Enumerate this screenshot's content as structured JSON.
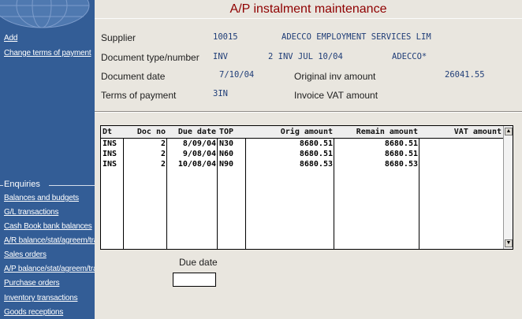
{
  "window": {
    "title": "A/P instalment maintenance"
  },
  "sidebar": {
    "actions": [
      {
        "label": "Add"
      },
      {
        "label": "Change terms of payment"
      }
    ],
    "enquiries_header": "Enquiries",
    "enquiries": [
      {
        "label": "Balances and budgets"
      },
      {
        "label": "G/L transactions"
      },
      {
        "label": "Cash Book bank balances"
      },
      {
        "label": "A/R balance/stat/agreem/tran"
      },
      {
        "label": "Sales orders"
      },
      {
        "label": "A/P balance/stat/agreem/tran"
      },
      {
        "label": "Purchase orders"
      },
      {
        "label": "Inventory transactions"
      },
      {
        "label": "Goods receptions"
      }
    ]
  },
  "header": {
    "supplier_label": "Supplier",
    "supplier_code": "10015",
    "supplier_name": "ADECCO EMPLOYMENT SERVICES LIM",
    "doc_label": "Document type/number",
    "doc_type": "INV",
    "doc_number": "2 INV  JUL 10/04",
    "doc_ref": "ADECCO*",
    "date_label": "Document date",
    "date_value": "7/10/04",
    "orig_label": "Original inv amount",
    "orig_value": "26041.55",
    "terms_label": "Terms of payment",
    "terms_value": "3IN",
    "vat_label": "Invoice VAT amount",
    "vat_value": ""
  },
  "grid": {
    "columns": [
      "Dt",
      "Doc no",
      "Due date",
      "TOP",
      "Orig amount",
      "Remain amount",
      "VAT amount"
    ],
    "rows": [
      [
        "INS",
        "2",
        "8/09/04",
        "N30",
        "8680.51",
        "8680.51",
        ""
      ],
      [
        "INS",
        "2",
        "9/08/04",
        "N60",
        "8680.51",
        "8680.51",
        ""
      ],
      [
        "INS",
        "2",
        "10/08/04",
        "N90",
        "8680.53",
        "8680.53",
        ""
      ]
    ]
  },
  "filter": {
    "due_date_label": "Due date",
    "due_date_value": ""
  }
}
